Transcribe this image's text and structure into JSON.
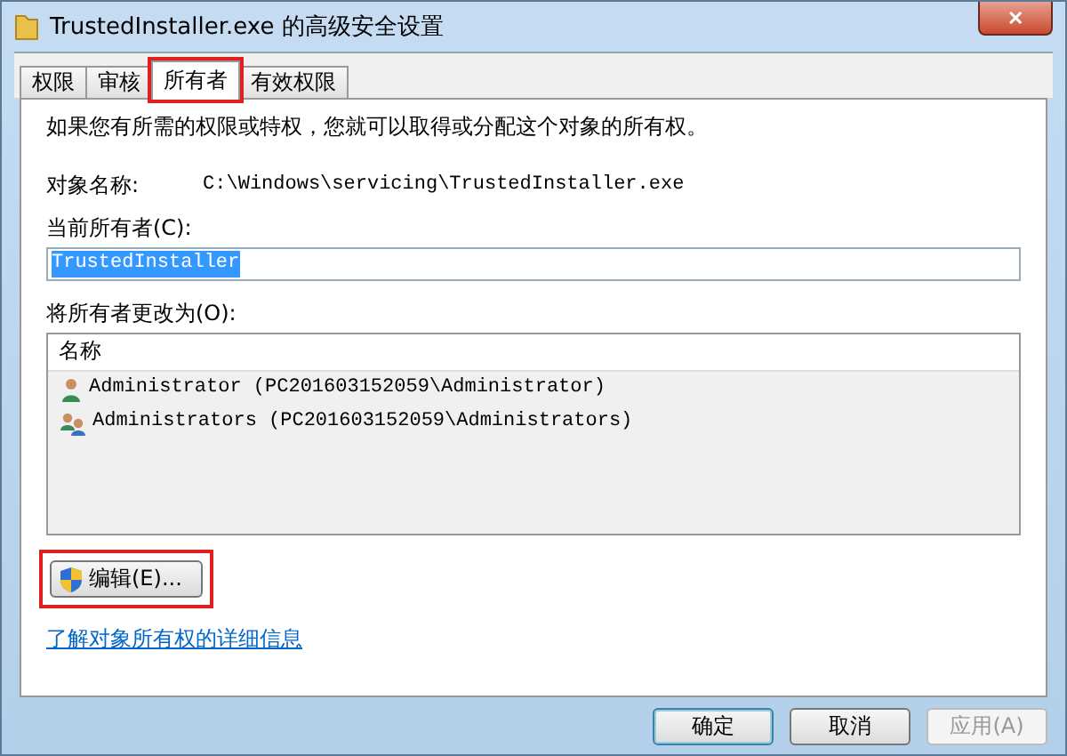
{
  "window": {
    "title": "TrustedInstaller.exe 的高级安全设置",
    "close": "✕"
  },
  "tabs": [
    {
      "label": "权限",
      "selected": false,
      "highlighted": false
    },
    {
      "label": "审核",
      "selected": false,
      "highlighted": false
    },
    {
      "label": "所有者",
      "selected": true,
      "highlighted": true
    },
    {
      "label": "有效权限",
      "selected": false,
      "highlighted": false
    }
  ],
  "intro": "如果您有所需的权限或特权，您就可以取得或分配这个对象的所有权。",
  "object_name": {
    "label": "对象名称:",
    "value": "C:\\Windows\\servicing\\TrustedInstaller.exe"
  },
  "current_owner": {
    "label": "当前所有者(C):",
    "value": "TrustedInstaller"
  },
  "change_owner": {
    "label": "将所有者更改为(O):",
    "column": "名称",
    "rows": [
      {
        "kind": "user",
        "name": "Administrator (PC201603152059\\Administrator)",
        "selected": false
      },
      {
        "kind": "group",
        "name": "Administrators (PC201603152059\\Administrators)",
        "selected": false
      }
    ]
  },
  "edit_button": {
    "label": "编辑(E)...",
    "highlighted": true
  },
  "link": "了解对象所有权的详细信息",
  "buttons": [
    {
      "label": "确定",
      "disabled": false,
      "default": true
    },
    {
      "label": "取消",
      "disabled": false,
      "default": false
    },
    {
      "label": "应用(A)",
      "disabled": true,
      "default": false
    }
  ]
}
